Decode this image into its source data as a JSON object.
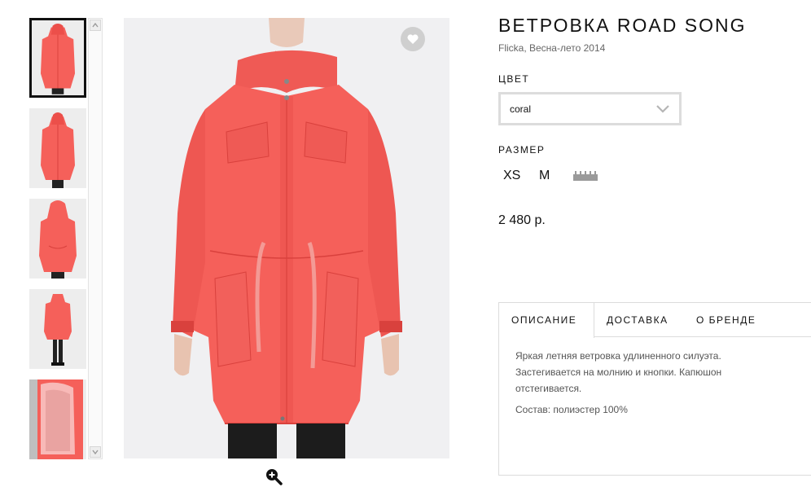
{
  "product": {
    "title": "ВЕТРОВКА ROAD SONG",
    "subtitle": "Flicka, Весна-лето 2014",
    "price": "2 480 р."
  },
  "color": {
    "label": "ЦВЕТ",
    "selected": "coral"
  },
  "size": {
    "label": "РАЗМЕР",
    "options": [
      "XS",
      "M"
    ]
  },
  "tabs": [
    {
      "label": "ОПИСАНИЕ"
    },
    {
      "label": "ДОСТАВКА"
    },
    {
      "label": "О БРЕНДЕ"
    }
  ],
  "description": {
    "text": "Яркая летняя ветровка удлиненного силуэта. Застегивается на молнию и кнопки. Капюшон отстегивается.",
    "composition": "Состав: полиэстер 100%"
  },
  "thumbnails": [
    {
      "view": "front"
    },
    {
      "view": "front"
    },
    {
      "view": "back"
    },
    {
      "view": "full-body"
    },
    {
      "view": "lining"
    }
  ],
  "icons": {
    "favorite": "heart-icon",
    "zoom": "zoom-in-icon",
    "dropdown": "chevron-down-icon",
    "size_chart": "ruler-icon",
    "scroll_up": "arrow-up-icon",
    "scroll_down": "arrow-down-icon"
  },
  "colors": {
    "jacket": "#f5605a",
    "jacket_dark": "#d9413d",
    "image_bg": "#f0f0f2",
    "border": "#dcdcdc",
    "text_muted": "#555555"
  }
}
